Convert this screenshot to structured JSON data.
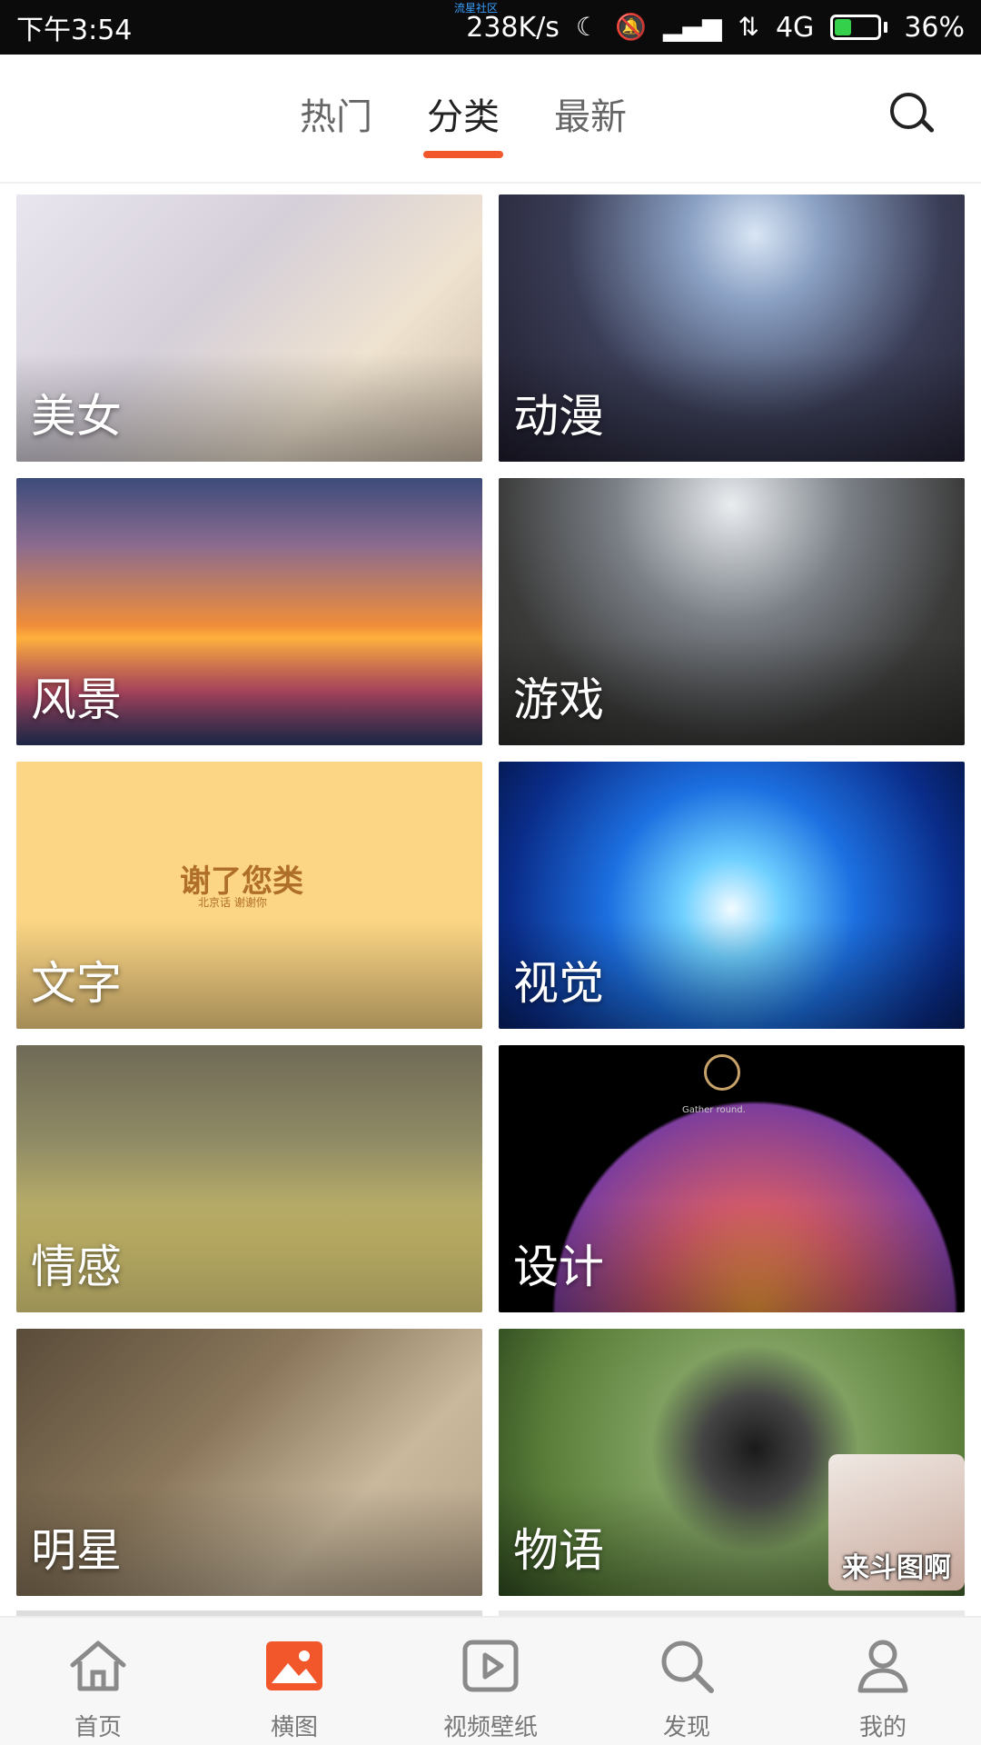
{
  "status_bar": {
    "time": "下午3:54",
    "network_speed": "238K/s",
    "network_type": "4G",
    "battery": "36%",
    "battery_level": 0.36,
    "top_center_text": "流星社区",
    "icons": [
      "moon-icon",
      "mute-bell-icon",
      "signal-icon",
      "data-arrows-icon",
      "battery-icon"
    ]
  },
  "top_nav": {
    "tabs": [
      {
        "label": "热门",
        "active": false
      },
      {
        "label": "分类",
        "active": true
      },
      {
        "label": "最新",
        "active": false
      }
    ],
    "search_icon": "search-icon",
    "accent_color": "#f2572b"
  },
  "categories": [
    {
      "label": "美女",
      "bg": "bg-meinv"
    },
    {
      "label": "动漫",
      "bg": "bg-dongman"
    },
    {
      "label": "风景",
      "bg": "bg-fengjing"
    },
    {
      "label": "游戏",
      "bg": "bg-youxi"
    },
    {
      "label": "文字",
      "bg": "bg-wenzi"
    },
    {
      "label": "视觉",
      "bg": "bg-shijue"
    },
    {
      "label": "情感",
      "bg": "bg-qinggan"
    },
    {
      "label": "设计",
      "bg": "bg-sheji"
    },
    {
      "label": "明星",
      "bg": "bg-mingxing"
    },
    {
      "label": "物语",
      "bg": "bg-wuyu"
    }
  ],
  "card_details": {
    "wenzi_title": "谢了您类",
    "wenzi_sub": "北京话 谢谢你",
    "sheji_caption": "Gather round."
  },
  "floating_thumb": {
    "label": "来斗图啊"
  },
  "bottom_nav": {
    "items": [
      {
        "label": "首页",
        "icon": "home-icon"
      },
      {
        "label": "横图",
        "icon": "image-icon",
        "active": true
      },
      {
        "label": "视频壁纸",
        "icon": "video-icon"
      },
      {
        "label": "发现",
        "icon": "discover-search-icon"
      },
      {
        "label": "我的",
        "icon": "user-icon"
      }
    ],
    "active_color": "#f2572b"
  }
}
